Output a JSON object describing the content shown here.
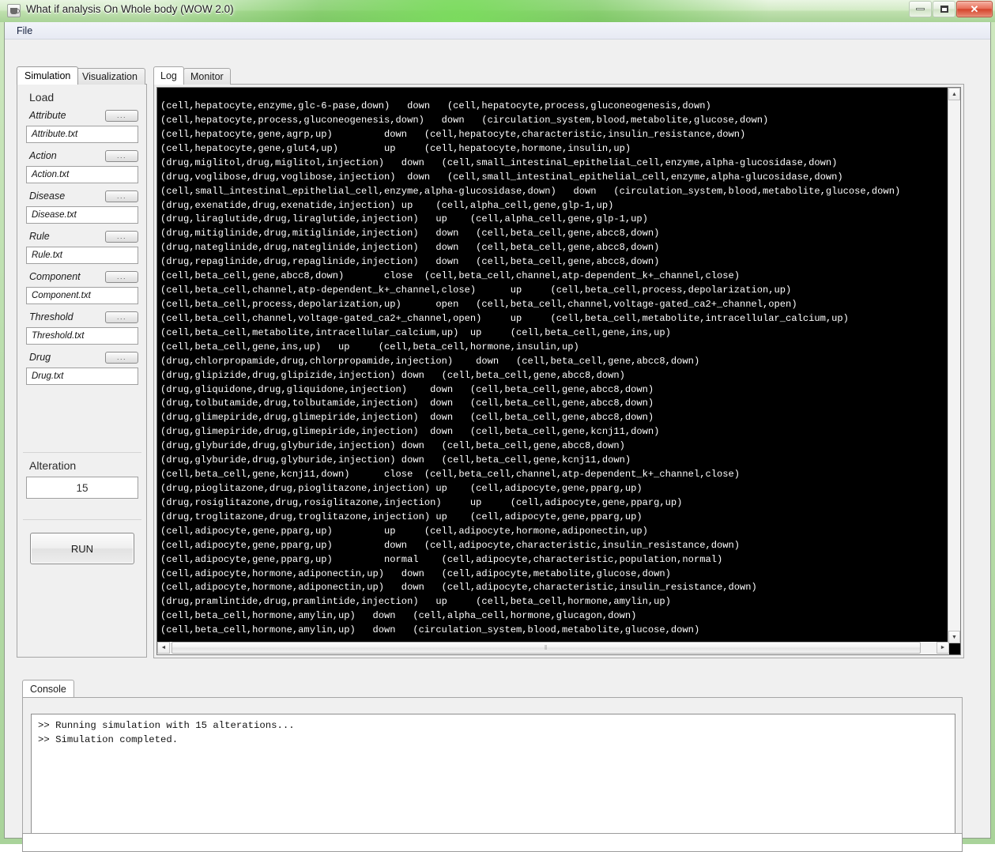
{
  "window": {
    "title": "What if analysis On Whole body (WOW 2.0)",
    "icon": "java-cup-icon",
    "minimize_label": "–",
    "maximize_label": "□",
    "close_label": "✕",
    "accent_titlebar": "#a9d398",
    "accent_close": "#d4452c"
  },
  "menubar": {
    "items": [
      {
        "label": "File"
      }
    ]
  },
  "left_panel": {
    "tabs": [
      {
        "label": "Simulation",
        "active": true
      },
      {
        "label": "Visualization",
        "active": false
      }
    ],
    "load": {
      "title": "Load",
      "browse_label": "...",
      "fields": [
        {
          "label": "Attribute",
          "value": "Attribute.txt"
        },
        {
          "label": "Action",
          "value": "Action.txt"
        },
        {
          "label": "Disease",
          "value": "Disease.txt"
        },
        {
          "label": "Rule",
          "value": "Rule.txt"
        },
        {
          "label": "Component",
          "value": "Component.txt"
        },
        {
          "label": "Threshold",
          "value": "Threshold.txt"
        },
        {
          "label": "Drug",
          "value": "Drug.txt"
        }
      ]
    },
    "alteration": {
      "title": "Alteration",
      "value": "15"
    },
    "run_button": {
      "label": "RUN"
    }
  },
  "log_panel": {
    "tabs": [
      {
        "label": "Log",
        "active": true
      },
      {
        "label": "Monitor",
        "active": false
      }
    ],
    "lines": [
      "(cell,hepatocyte,enzyme,glc-6-pase,down)   down   (cell,hepatocyte,process,gluconeogenesis,down)",
      "(cell,hepatocyte,process,gluconeogenesis,down)   down   (circulation_system,blood,metabolite,glucose,down)",
      "(cell,hepatocyte,gene,agrp,up)         down   (cell,hepatocyte,characteristic,insulin_resistance,down)",
      "(cell,hepatocyte,gene,glut4,up)        up     (cell,hepatocyte,hormone,insulin,up)",
      "(drug,miglitol,drug,miglitol,injection)   down   (cell,small_intestinal_epithelial_cell,enzyme,alpha-glucosidase,down)",
      "(drug,voglibose,drug,voglibose,injection)  down   (cell,small_intestinal_epithelial_cell,enzyme,alpha-glucosidase,down)",
      "(cell,small_intestinal_epithelial_cell,enzyme,alpha-glucosidase,down)   down   (circulation_system,blood,metabolite,glucose,down)",
      "(drug,exenatide,drug,exenatide,injection) up    (cell,alpha_cell,gene,glp-1,up)",
      "(drug,liraglutide,drug,liraglutide,injection)   up    (cell,alpha_cell,gene,glp-1,up)",
      "(drug,mitiglinide,drug,mitiglinide,injection)   down   (cell,beta_cell,gene,abcc8,down)",
      "(drug,nateglinide,drug,nateglinide,injection)   down   (cell,beta_cell,gene,abcc8,down)",
      "(drug,repaglinide,drug,repaglinide,injection)   down   (cell,beta_cell,gene,abcc8,down)",
      "(cell,beta_cell,gene,abcc8,down)       close  (cell,beta_cell,channel,atp-dependent_k+_channel,close)",
      "(cell,beta_cell,channel,atp-dependent_k+_channel,close)      up     (cell,beta_cell,process,depolarization,up)",
      "(cell,beta_cell,process,depolarization,up)      open   (cell,beta_cell,channel,voltage-gated_ca2+_channel,open)",
      "(cell,beta_cell,channel,voltage-gated_ca2+_channel,open)     up     (cell,beta_cell,metabolite,intracellular_calcium,up)",
      "(cell,beta_cell,metabolite,intracellular_calcium,up)  up     (cell,beta_cell,gene,ins,up)",
      "(cell,beta_cell,gene,ins,up)   up     (cell,beta_cell,hormone,insulin,up)",
      "(drug,chlorpropamide,drug,chlorpropamide,injection)    down   (cell,beta_cell,gene,abcc8,down)",
      "(drug,glipizide,drug,glipizide,injection) down   (cell,beta_cell,gene,abcc8,down)",
      "(drug,gliquidone,drug,gliquidone,injection)    down   (cell,beta_cell,gene,abcc8,down)",
      "(drug,tolbutamide,drug,tolbutamide,injection)  down   (cell,beta_cell,gene,abcc8,down)",
      "(drug,glimepiride,drug,glimepiride,injection)  down   (cell,beta_cell,gene,abcc8,down)",
      "(drug,glimepiride,drug,glimepiride,injection)  down   (cell,beta_cell,gene,kcnj11,down)",
      "(drug,glyburide,drug,glyburide,injection) down   (cell,beta_cell,gene,abcc8,down)",
      "(drug,glyburide,drug,glyburide,injection) down   (cell,beta_cell,gene,kcnj11,down)",
      "(cell,beta_cell,gene,kcnj11,down)      close  (cell,beta_cell,channel,atp-dependent_k+_channel,close)",
      "(drug,pioglitazone,drug,pioglitazone,injection) up    (cell,adipocyte,gene,pparg,up)",
      "(drug,rosiglitazone,drug,rosiglitazone,injection)     up     (cell,adipocyte,gene,pparg,up)",
      "(drug,troglitazone,drug,troglitazone,injection) up    (cell,adipocyte,gene,pparg,up)",
      "(cell,adipocyte,gene,pparg,up)         up     (cell,adipocyte,hormone,adiponectin,up)",
      "(cell,adipocyte,gene,pparg,up)         down   (cell,adipocyte,characteristic,insulin_resistance,down)",
      "(cell,adipocyte,gene,pparg,up)         normal    (cell,adipocyte,characteristic,population,normal)",
      "(cell,adipocyte,hormone,adiponectin,up)   down   (cell,adipocyte,metabolite,glucose,down)",
      "(cell,adipocyte,hormone,adiponectin,up)   down   (cell,adipocyte,characteristic,insulin_resistance,down)",
      "(drug,pramlintide,drug,pramlintide,injection)   up     (cell,beta_cell,hormone,amylin,up)",
      "(cell,beta_cell,hormone,amylin,up)   down   (cell,alpha_cell,hormone,glucagon,down)",
      "(cell,beta_cell,hormone,amylin,up)   down   (circulation_system,blood,metabolite,glucose,down)"
    ],
    "scrollbar": {
      "up_arrow": "▲",
      "down_arrow": "▼",
      "left_arrow": "◄",
      "right_arrow": "►",
      "grip": "‖"
    }
  },
  "console": {
    "tab_label": "Console",
    "lines": [
      ">> Running simulation with 15 alterations...",
      ">> Simulation completed."
    ],
    "command_input_value": ""
  }
}
